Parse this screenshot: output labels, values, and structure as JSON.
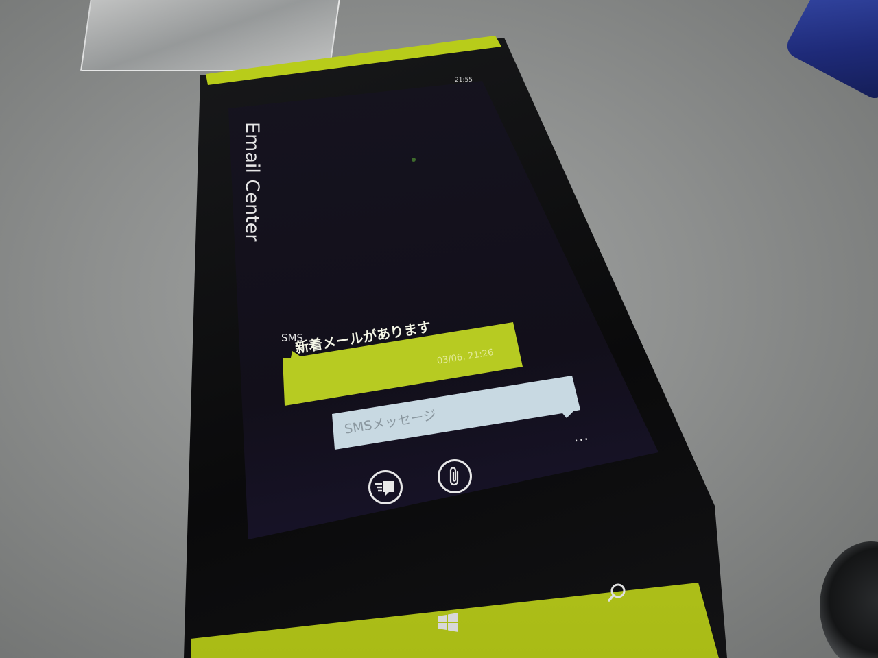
{
  "status_bar": {
    "time": "21:55"
  },
  "app": {
    "title": "Email Center"
  },
  "conversation": {
    "sender": "SMS",
    "message": {
      "text": "新着メールがあります",
      "timestamp": "03/06, 21:26"
    }
  },
  "composer": {
    "placeholder": "SMSメッセージ",
    "more_menu": "..."
  },
  "app_bar": {
    "buttons": [
      {
        "icon": "send-icon"
      },
      {
        "icon": "attach-icon"
      }
    ]
  },
  "hardware_buttons": [
    "windows-start-icon",
    "search-icon"
  ],
  "colors": {
    "accent": "#b7cb22",
    "screen_background": "#141219",
    "compose_box": "#c8d9e2",
    "phone_body": "#0e0e10",
    "phone_trim": "#b8cc1a"
  }
}
